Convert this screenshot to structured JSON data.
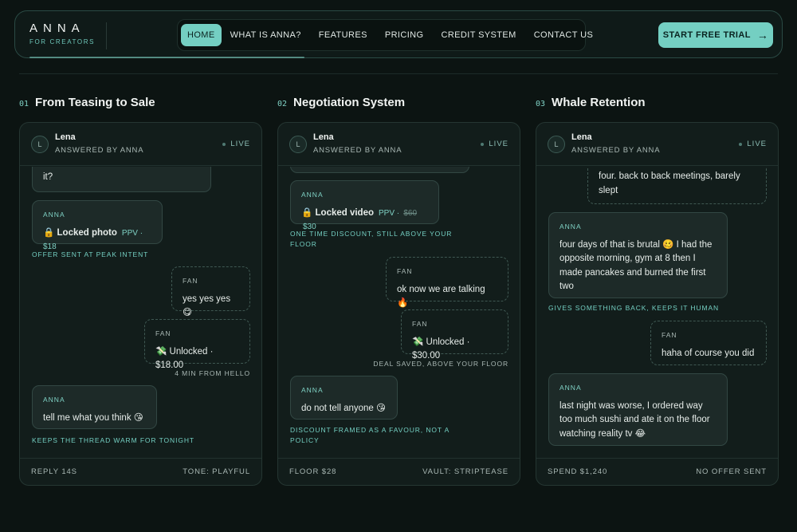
{
  "brand": {
    "name": "ANNA",
    "tagline": "FOR CREATORS"
  },
  "nav": {
    "items": [
      {
        "label": "HOME",
        "active": true
      },
      {
        "label": "WHAT IS ANNA?"
      },
      {
        "label": "FEATURES"
      },
      {
        "label": "PRICING"
      },
      {
        "label": "CREDIT SYSTEM"
      },
      {
        "label": "CONTACT US"
      }
    ]
  },
  "cta": {
    "label": "START FREE TRIAL",
    "icon": "arrow-right-icon"
  },
  "colors": {
    "accent": "#74cfc2",
    "background": "#0c1412",
    "card": "#121d1b"
  },
  "columns": [
    {
      "num": "01",
      "title": "From Teasing to Sale",
      "card": {
        "name": "Lena",
        "sub": "ANSWERED BY ANNA",
        "status": "LIVE",
        "avatar": "L",
        "messages": [
          {
            "role": "",
            "text": "it?"
          },
          {
            "role": "ANNA",
            "title": "🔒 Locked photo",
            "price": "PPV · $18"
          },
          {
            "caption": "OFFER SENT AT PEAK INTENT"
          },
          {
            "role": "FAN",
            "text": "yes yes yes 😋"
          },
          {
            "role": "FAN",
            "text": "💸 Unlocked · $18.00"
          },
          {
            "caption": "4 MIN FROM HELLO"
          },
          {
            "role": "ANNA",
            "text": "tell me what you think 😘"
          },
          {
            "caption": "KEEPS THE THREAD WARM FOR TONIGHT"
          }
        ],
        "footer": {
          "left": "REPLY 14S",
          "right": "TONE: PLAYFUL"
        }
      }
    },
    {
      "num": "02",
      "title": "Negotiation System",
      "card": {
        "name": "Lena",
        "sub": "ANSWERED BY ANNA",
        "status": "LIVE",
        "avatar": "L",
        "messages": [
          {
            "role": "ANNA",
            "title": "🔒 Locked video",
            "ppv": "PPV ·",
            "old_price": "$60",
            "price": "$30"
          },
          {
            "caption": "ONE TIME DISCOUNT, STILL ABOVE YOUR FLOOR"
          },
          {
            "role": "FAN",
            "text": "ok now we are talking 🔥"
          },
          {
            "role": "FAN",
            "text": "💸 Unlocked · $30.00"
          },
          {
            "caption": "DEAL SAVED, ABOVE YOUR FLOOR"
          },
          {
            "role": "ANNA",
            "text": "do not tell anyone 😘"
          },
          {
            "caption": "DISCOUNT FRAMED AS A FAVOUR, NOT A POLICY"
          }
        ],
        "footer": {
          "left": "FLOOR $28",
          "right": "VAULT: STRIPTEASE"
        }
      }
    },
    {
      "num": "03",
      "title": "Whale Retention",
      "card": {
        "name": "Lena",
        "sub": "ANSWERED BY ANNA",
        "status": "LIVE",
        "avatar": "L",
        "messages": [
          {
            "role": "",
            "text": "four. back to back meetings, barely slept"
          },
          {
            "role": "ANNA",
            "text": "four days of that is brutal 🥴 I had the opposite morning, gym at 8 then I made pancakes and burned the first two"
          },
          {
            "caption": "GIVES SOMETHING BACK, KEEPS IT HUMAN"
          },
          {
            "role": "FAN",
            "text": "haha of course you did"
          },
          {
            "role": "ANNA",
            "text": "last night was worse, I ordered way too much sushi and ate it on the floor watching reality tv 😂"
          }
        ],
        "footer": {
          "left": "SPEND $1,240",
          "right": "NO OFFER SENT"
        }
      }
    }
  ]
}
